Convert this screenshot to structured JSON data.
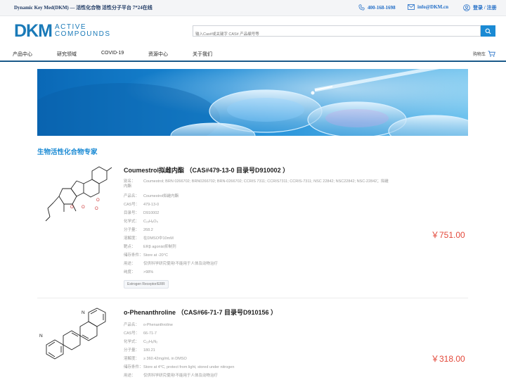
{
  "topbar": {
    "tagline": "Dynamic Key Med(DKM) — 活性化合物 活性分子平台 7*24在线",
    "phone": "400-168-1698",
    "email": "info@DKM.cn",
    "login": "登录 / 注册",
    "icons": [
      "phone-icon",
      "mail-icon",
      "user-icon"
    ]
  },
  "header": {
    "logo_mark": "DKM",
    "logo_line1": "ACTIVE",
    "logo_line2": "COMPOUNDS",
    "search_placeholder": "输入Cas#或关键字 CAS# 产品编号等"
  },
  "nav": {
    "items": [
      "产品中心",
      "研究领域",
      "COVID-19",
      "资源中心",
      "关于我们"
    ],
    "cart": "购物车"
  },
  "section_title": "生物活性化合物专家",
  "products": [
    {
      "name": "Coumestrol拟雌内酯 （CAS#479-13-0 目录号D910002 ）",
      "specs": [
        {
          "k": "别名：",
          "v": "Coumestrol; BRN 0266702; BRN0266702; BRN-0266702; CCRIS 7311; CCRIS7311; CCRIS-7311; NSC 22842; NSC22842; NSC-22842；拟雌内酯"
        },
        {
          "k": "产品名：",
          "v": "Coumestrol拟雌内酯"
        },
        {
          "k": "CAS号：",
          "v": "479-13-0"
        },
        {
          "k": "目录号：",
          "v": "D910002"
        },
        {
          "k": "化学式：",
          "v": "C₁₅H₈O₅"
        },
        {
          "k": "分子量：",
          "v": "268.2"
        },
        {
          "k": "溶解度：",
          "v": "在DMSO中10mM"
        },
        {
          "k": "靶点：",
          "v": "ERβ agonist抑制剂"
        },
        {
          "k": "储存条件：",
          "v": "Store at -20°C"
        },
        {
          "k": "用途：",
          "v": "仅供科学研究使用!不能用于人体及动物治疗"
        },
        {
          "k": "纯度：",
          "v": ">98%"
        }
      ],
      "price": "￥751.00",
      "tag": "Estrogen Receptor/ERR"
    },
    {
      "name": "o-Phenanthroline （CAS#66-71-7 目录号D910156 ）",
      "specs": [
        {
          "k": "产品名：",
          "v": "o-Phenanthroline"
        },
        {
          "k": "CAS号：",
          "v": "66-71-7"
        },
        {
          "k": "化学式：",
          "v": "C₁₂H₈N₂"
        },
        {
          "k": "分子量：",
          "v": "180.21"
        },
        {
          "k": "溶解度：",
          "v": "≥ 360.42mg/mL in DMSO"
        },
        {
          "k": "储存条件：",
          "v": "Store at 4°C, protect from light, stored under nitrogen"
        },
        {
          "k": "用途：",
          "v": "仅供科学研究使用!不能用于人体及动物治疗"
        }
      ],
      "price": "￥318.00"
    }
  ],
  "colors": {
    "accent": "#1a8ad4",
    "brand": "#1a7ab8",
    "price": "#e3493b",
    "nav_border": "#1a5a8a"
  }
}
